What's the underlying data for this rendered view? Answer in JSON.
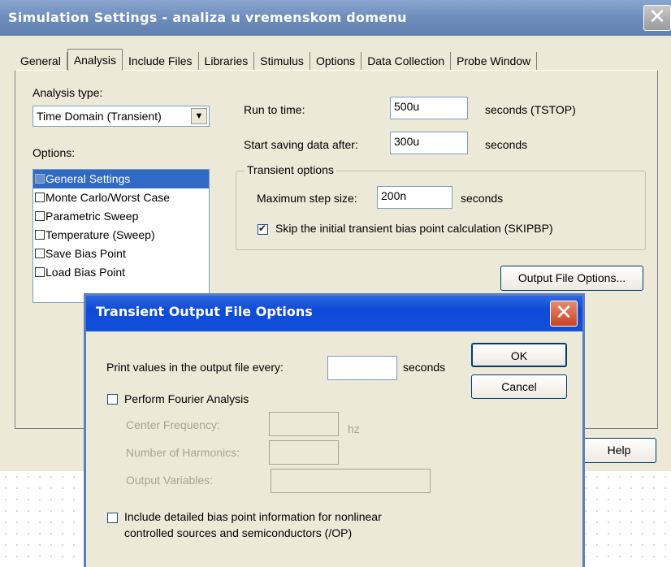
{
  "window": {
    "title": "Simulation Settings - analiza u vremenskom domenu"
  },
  "tabs": [
    "General",
    "Analysis",
    "Include Files",
    "Libraries",
    "Stimulus",
    "Options",
    "Data Collection",
    "Probe Window"
  ],
  "active_tab": "Analysis",
  "analysis": {
    "type_label": "Analysis type:",
    "type_value": "Time Domain (Transient)",
    "options_label": "Options:",
    "options": [
      "General Settings",
      "Monte Carlo/Worst Case",
      "Parametric Sweep",
      "Temperature (Sweep)",
      "Save Bias Point",
      "Load Bias Point"
    ],
    "run_to_label": "Run to time:",
    "run_to_value": "500u",
    "run_to_unit": "seconds  (TSTOP)",
    "start_save_label": "Start saving data after:",
    "start_save_value": "300u",
    "start_save_unit": "seconds",
    "transient_group": "Transient options",
    "max_step_label": "Maximum step size:",
    "max_step_value": "200n",
    "max_step_unit": "seconds",
    "skip_bias_label": "Skip the initial transient bias point calculation  (SKIPBP)",
    "skip_bias_checked": true,
    "output_file_options_button": "Output File Options...",
    "help_button": "Help"
  },
  "dialog": {
    "title": "Transient Output File Options",
    "print_label": "Print values in the output file every:",
    "print_value": "",
    "print_unit": "seconds",
    "ok_button": "OK",
    "cancel_button": "Cancel",
    "fourier_label": "Perform Fourier Analysis",
    "fourier_checked": false,
    "center_freq_label": "Center Frequency:",
    "center_freq_unit": "hz",
    "harmonics_label": "Number of Harmonics:",
    "output_vars_label": "Output Variables:",
    "bias_info_line1": "Include detailed bias point information for nonlinear",
    "bias_info_line2": "controlled sources and semiconductors (/OP)",
    "bias_info_checked": false
  },
  "icons": {
    "close": "close-x-icon",
    "dropdown": "chevron-down-icon",
    "check": "checkmark-icon"
  },
  "colors": {
    "main_title": "#6f8fbd",
    "dialog_title": "#0f4ad7",
    "close": "#c94322",
    "selection": "#316ac5",
    "face": "#ece9d8"
  }
}
